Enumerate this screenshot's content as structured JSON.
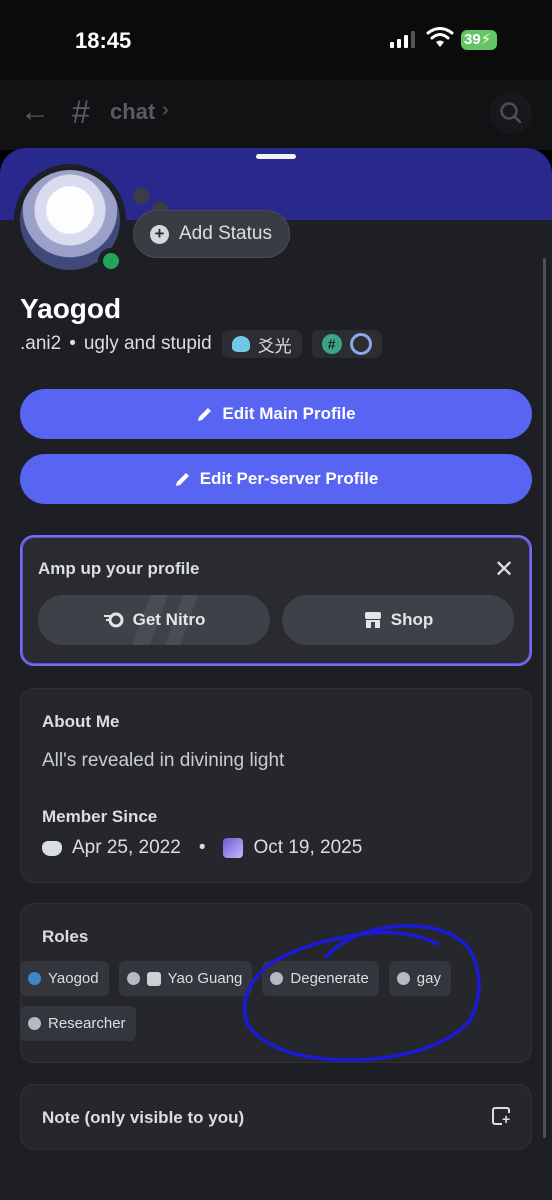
{
  "status_bar": {
    "time": "18:45",
    "battery": "39"
  },
  "header": {
    "channel_name": "chat"
  },
  "profile": {
    "add_status_label": "Add Status",
    "username": "Yaogod",
    "handle": ".ani2",
    "separator": "•",
    "pronouns": "ugly and stupid",
    "tag_text": "爻光"
  },
  "actions": {
    "edit_main_profile": "Edit Main Profile",
    "edit_per_server_profile": "Edit Per-server Profile"
  },
  "amp": {
    "title": "Amp up your profile",
    "close": "✕",
    "get_nitro": "Get Nitro",
    "shop": "Shop"
  },
  "about": {
    "heading": "About Me",
    "text": "All's revealed in divining light",
    "member_since_heading": "Member Since",
    "discord_date": "Apr 25, 2022",
    "date_separator": "•",
    "server_date": "Oct 19, 2025"
  },
  "roles": {
    "heading": "Roles",
    "items": [
      {
        "label": "Yaogod",
        "color": "#3f86c7"
      },
      {
        "label": "Yao Guang",
        "color": "#b5b9c0"
      },
      {
        "label": "Degenerate",
        "color": "#b5b9c0"
      },
      {
        "label": "gay",
        "color": "#b5b9c0"
      },
      {
        "label": "Researcher",
        "color": "#b5b9c0"
      }
    ]
  },
  "note": {
    "label": "Note (only visible to you)"
  },
  "colors": {
    "accent": "#5865f2",
    "banner": "#29288c",
    "online": "#23a559",
    "annotation": "#1a1ad8"
  }
}
